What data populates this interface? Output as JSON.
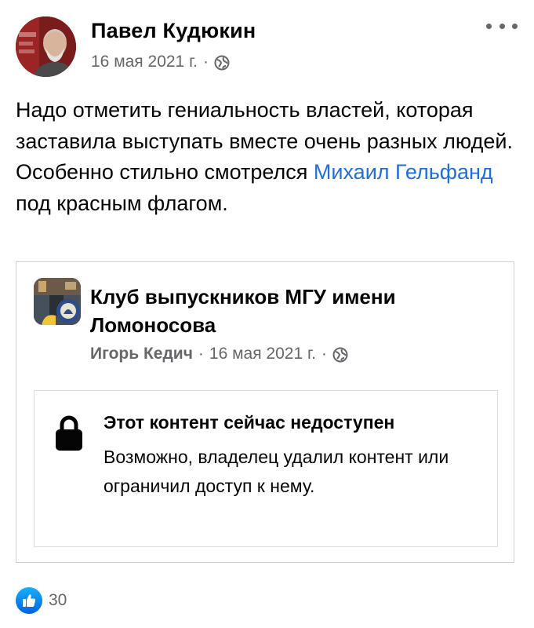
{
  "post": {
    "author": "Павел Кудюкин",
    "date": "16 мая 2021 г.",
    "separator": "·",
    "privacy_icon": "globe-icon",
    "more_icon": "more-dots-icon",
    "text_part1": "Надо отметить гениальность властей, которая заставила выступать вместе очень разных людей. Особенно стильно смотрелся ",
    "mention": "Михаил Гельфанд",
    "text_part2": " под красным флагом."
  },
  "shared": {
    "group_name": "Клуб выпускников МГУ имени Ломоносова",
    "poster": "Игорь Кедич",
    "date": "16 мая 2021 г.",
    "separator": "·",
    "privacy_icon": "globe-icon",
    "unavailable": {
      "icon": "lock-icon",
      "title": "Этот контент сейчас недоступен",
      "body": "Возможно, владелец удалил контент или ограничил доступ к нему."
    }
  },
  "reactions": {
    "icon": "like-icon",
    "count": "30"
  },
  "colors": {
    "link": "#216fdb",
    "secondary_text": "#65676b",
    "like_blue": "#0a7cff"
  }
}
